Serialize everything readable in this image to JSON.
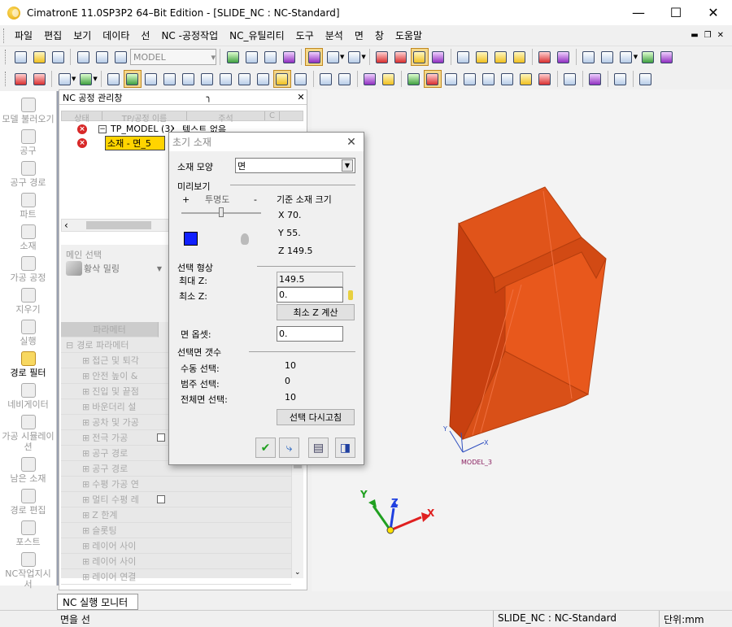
{
  "window": {
    "title": "CimatronE 11.0SP3P2 64–Bit Edition - [SLIDE_NC : NC-Standard]"
  },
  "menu": [
    "파일",
    "편집",
    "보기",
    "데이타",
    "선",
    "NC -공정작업",
    "NC_유틸리티",
    "도구",
    "분석",
    "면",
    "창",
    "도움말"
  ],
  "toolbar": {
    "model_combo": "MODEL"
  },
  "sidebar": {
    "items": [
      "모델 불러오기",
      "공구",
      "공구 경로",
      "파트",
      "소재",
      "가공 공정",
      "지우기",
      "실행",
      "경로 필터",
      "네비게이터",
      "가공 시뮬레이션",
      "남은 소재",
      "경로 편집",
      "포스트",
      "NC작업지시서"
    ]
  },
  "nc_panel": {
    "title": "NC 공정 관리창",
    "columns": [
      "상태",
      "TP/공정 이름",
      "주석",
      "C"
    ],
    "rows": [
      {
        "name": "TP_MODEL (3X",
        "comment": "텍스트 없음"
      },
      {
        "name": "소재 - 면_5",
        "comment": ""
      }
    ],
    "main_select_label": "메인 선택",
    "main_select_value": "황삭 밀링",
    "param_header": "파라메터",
    "params": [
      "경로 파라메터",
      "접근 및 퇴각",
      "안전 높이 &",
      "진입 및 끝점",
      "바운더리 설",
      "공차 및 가공",
      "전극 가공",
      "공구 경로",
      "공구 경로",
      "수평 가공 연",
      "멀티 수평 레",
      "Z 한계",
      "슬롯팅",
      "레이어 사이",
      "레이어 사이",
      "레이어 연결"
    ]
  },
  "dialog": {
    "title": "초기 소재",
    "shape_label": "소재 모양",
    "shape_value": "면",
    "preview_label": "미리보기",
    "transparency_label": "투명도",
    "plus": "+",
    "minus": "-",
    "ref_size_label": "기준 소재 크기",
    "x": "X  70.",
    "y": "Y  55.",
    "z": "Z  149.5",
    "sel_shape_label": "선택 형상",
    "max_z_label": "최대 Z:",
    "max_z_value": "149.5",
    "min_z_label": "최소 Z:",
    "min_z_value": "0.",
    "calc_min_z_button": "최소 Z 계산",
    "face_offset_label": "면 옵셋:",
    "face_offset_value": "0.",
    "face_count_label": "선택면 갯수",
    "manual_label": "수동 선택:",
    "manual_value": "10",
    "category_label": "범주 선택:",
    "category_value": "0",
    "total_label": "전체면 선택:",
    "total_value": "10",
    "reselect_button": "선택 다시고침"
  },
  "viewport": {
    "model_label": "MODEL_3"
  },
  "bottom_tab": "NC 실행 모니터",
  "status": {
    "left": "면을 선",
    "doc": "SLIDE_NC : NC-Standard",
    "unit": "단위:mm"
  }
}
